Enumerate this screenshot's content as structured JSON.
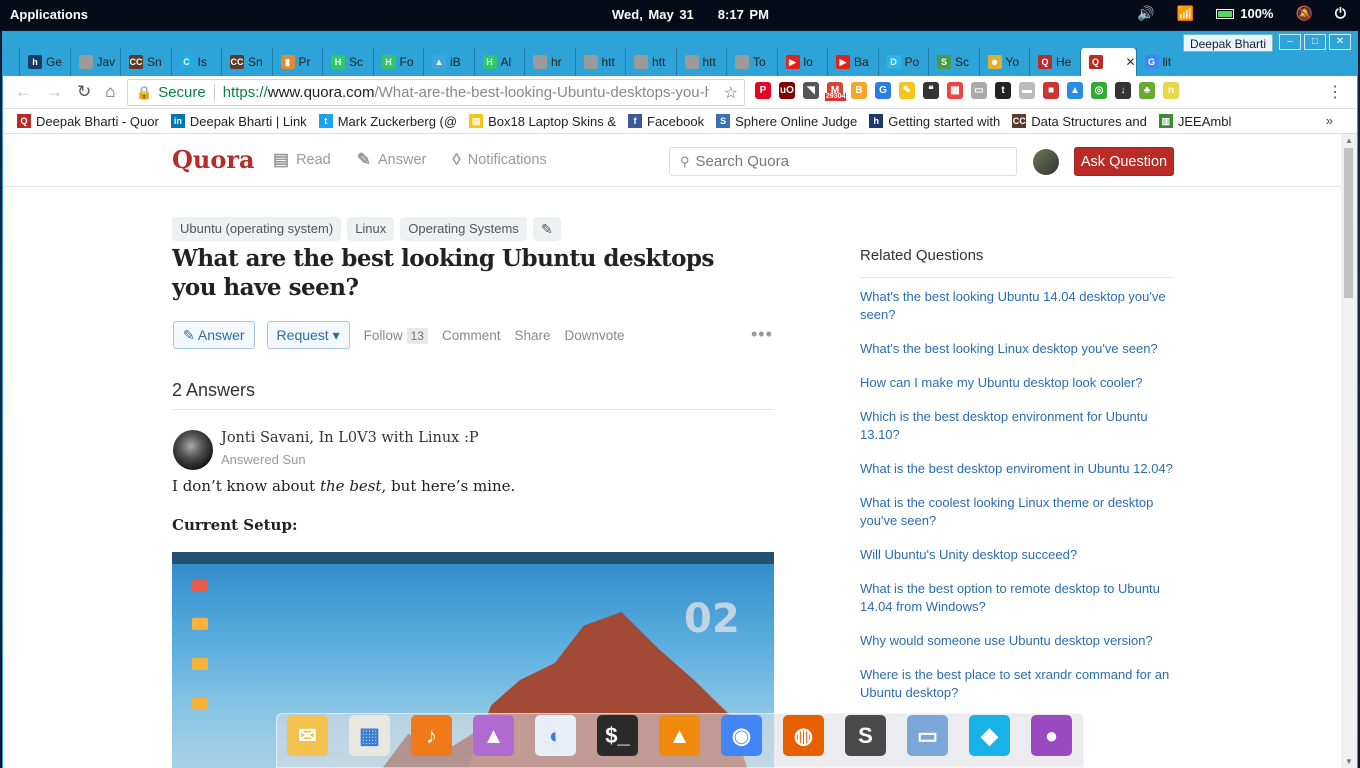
{
  "panel": {
    "apps": "Applications",
    "date": "Wed, May 31",
    "time": "8:17 PM",
    "battery": "100%"
  },
  "browser": {
    "profile": "Deepak Bharti",
    "tabs": [
      {
        "label": "Ge",
        "icon": "h",
        "color": "#1a3a6b"
      },
      {
        "label": "Jav",
        "icon": "",
        "color": "#9a9a9a"
      },
      {
        "label": "Sn",
        "icon": "CC",
        "color": "#5a3a2a"
      },
      {
        "label": "Is",
        "icon": "C",
        "color": "#1eaee0"
      },
      {
        "label": "Sn",
        "icon": "CC",
        "color": "#5a3a2a"
      },
      {
        "label": "Pr",
        "icon": "▮",
        "color": "#e58a2e"
      },
      {
        "label": "Sc",
        "icon": "H",
        "color": "#2ec866"
      },
      {
        "label": "Fo",
        "icon": "H",
        "color": "#2ec866"
      },
      {
        "label": "iB",
        "icon": "▲",
        "color": "#3aa7e0"
      },
      {
        "label": "Al",
        "icon": "H",
        "color": "#2ec866"
      },
      {
        "label": "hr",
        "icon": "",
        "color": "#9a9a9a"
      },
      {
        "label": "htt",
        "icon": "",
        "color": "#9a9a9a"
      },
      {
        "label": "htt",
        "icon": "",
        "color": "#9a9a9a"
      },
      {
        "label": "htt",
        "icon": "",
        "color": "#9a9a9a"
      },
      {
        "label": "To",
        "icon": "",
        "color": "#9a9a9a"
      },
      {
        "label": "lo",
        "icon": "▶",
        "color": "#e62117"
      },
      {
        "label": "Ba",
        "icon": "▶",
        "color": "#e62117"
      },
      {
        "label": "Po",
        "icon": "D",
        "color": "#2ab7e6"
      },
      {
        "label": "Sc",
        "icon": "S",
        "color": "#4a9a4a"
      },
      {
        "label": "Yo",
        "icon": "☻",
        "color": "#e0b02e"
      },
      {
        "label": "He",
        "icon": "Q",
        "color": "#b92b27"
      },
      {
        "label": "",
        "icon": "Q",
        "color": "#b92b27"
      },
      {
        "label": "lit",
        "icon": "G",
        "color": "#4285f4"
      }
    ],
    "close_glyph": "✕",
    "omnibox": {
      "secure": "Secure",
      "scheme": "https://",
      "host": "www.quora.com",
      "path": "/What-are-the-best-looking-Ubuntu-desktops-you-have-seen"
    },
    "extensions": [
      {
        "icon": "P",
        "color": "#e60023"
      },
      {
        "icon": "uO",
        "color": "#800000"
      },
      {
        "icon": "◥",
        "color": "#555"
      },
      {
        "icon": "M",
        "color": "#d44638"
      },
      {
        "icon": "B",
        "color": "#f5a623"
      },
      {
        "icon": "G",
        "color": "#2a7de1"
      },
      {
        "icon": "✎",
        "color": "#f5c518"
      },
      {
        "icon": "❝",
        "color": "#333"
      },
      {
        "icon": "▦",
        "color": "#e44"
      },
      {
        "icon": "▭",
        "color": "#aaa"
      },
      {
        "icon": "t",
        "color": "#222"
      },
      {
        "icon": "▬",
        "color": "#bbb"
      },
      {
        "icon": "■",
        "color": "#c33"
      },
      {
        "icon": "▲",
        "color": "#2a8de1"
      },
      {
        "icon": "◎",
        "color": "#3a3"
      },
      {
        "icon": "↓",
        "color": "#333"
      },
      {
        "icon": "♣",
        "color": "#6a3"
      },
      {
        "icon": "n",
        "color": "#e8d84a"
      }
    ],
    "bookmarks": [
      {
        "label": "Deepak Bharti - Quor",
        "icon": "Q",
        "color": "#b92b27"
      },
      {
        "label": "Deepak Bharti | Link",
        "icon": "in",
        "color": "#0077b5"
      },
      {
        "label": "Mark Zuckerberg (@",
        "icon": "t",
        "color": "#1da1f2"
      },
      {
        "label": "Box18 Laptop Skins &",
        "icon": "▤",
        "color": "#f5c518"
      },
      {
        "label": "Facebook",
        "icon": "f",
        "color": "#3b5998"
      },
      {
        "label": "Sphere Online Judge",
        "icon": "S",
        "color": "#3a6fb0"
      },
      {
        "label": "Getting started with",
        "icon": "h",
        "color": "#1a3a6b"
      },
      {
        "label": "Data Structures and",
        "icon": "CC",
        "color": "#5a3a2a"
      },
      {
        "label": "JEEAmbl",
        "icon": "▥",
        "color": "#3a8a3a"
      }
    ],
    "bookmarks_more": "»"
  },
  "quora": {
    "logo": "Quora",
    "nav": {
      "read": "Read",
      "answer": "Answer",
      "notifications": "Notifications"
    },
    "search_placeholder": "Search Quora",
    "ask_button": "Ask Question",
    "topics": [
      "Ubuntu (operating system)",
      "Linux",
      "Operating Systems"
    ],
    "question_title": "What are the best looking Ubuntu desktops you have seen?",
    "actions": {
      "answer": "Answer",
      "request": "Request ▾",
      "follow": "Follow",
      "follow_count": "13",
      "comment": "Comment",
      "share": "Share",
      "downvote": "Downvote"
    },
    "answers_heading": "2 Answers",
    "answer": {
      "author": "Jonti Savani, In L0V3 with Linux :P",
      "date": "Answered Sun",
      "line1_pre": "I don’t know about ",
      "line1_em": "the best",
      "line1_post": ", but here’s mine.",
      "setup_heading": "Current Setup:",
      "screenshot_clock": "02"
    },
    "related": {
      "heading": "Related Questions",
      "items": [
        "What's the best looking Ubuntu 14.04 desktop you've seen?",
        "What's the best looking Linux desktop you've seen?",
        "How can I make my Ubuntu desktop look cooler?",
        "Which is the best desktop environment for Ubuntu 13.10?",
        "What is the best desktop enviroment in Ubuntu 12.04?",
        "What is the coolest looking Linux theme or desktop you've seen?",
        "Will Ubuntu's Unity desktop succeed?",
        "What is the best option to remote desktop to Ubuntu 14.04 from Windows?",
        "Why would someone use Ubuntu desktop version?",
        "Where is the best place to set xrandr command for an Ubuntu desktop?"
      ]
    }
  },
  "dock": [
    {
      "name": "mail-icon",
      "glyph": "✉",
      "color": "#f2c14e"
    },
    {
      "name": "calendar-icon",
      "glyph": "▦",
      "color": "#e8e8e0"
    },
    {
      "name": "music-icon",
      "glyph": "♪",
      "color": "#f07a1a"
    },
    {
      "name": "photos-icon",
      "glyph": "▲",
      "color": "#b06ad0"
    },
    {
      "name": "settings-toggle-icon",
      "glyph": "◐",
      "color": "#e8eef6"
    },
    {
      "name": "terminal-icon",
      "glyph": "$_",
      "color": "#2a2a2a"
    },
    {
      "name": "vlc-icon",
      "glyph": "▲",
      "color": "#f08a0c"
    },
    {
      "name": "chrome-icon",
      "glyph": "◉",
      "color": "#4285f4"
    },
    {
      "name": "firefox-icon",
      "glyph": "◍",
      "color": "#e66000"
    },
    {
      "name": "sublime-icon",
      "glyph": "S",
      "color": "#4a4a4a"
    },
    {
      "name": "files-icon",
      "glyph": "▭",
      "color": "#7aa7d8"
    },
    {
      "name": "kodi-icon",
      "glyph": "◆",
      "color": "#17b2e7"
    },
    {
      "name": "screen-recorder-icon",
      "glyph": "●",
      "color": "#9a4ac0"
    }
  ]
}
